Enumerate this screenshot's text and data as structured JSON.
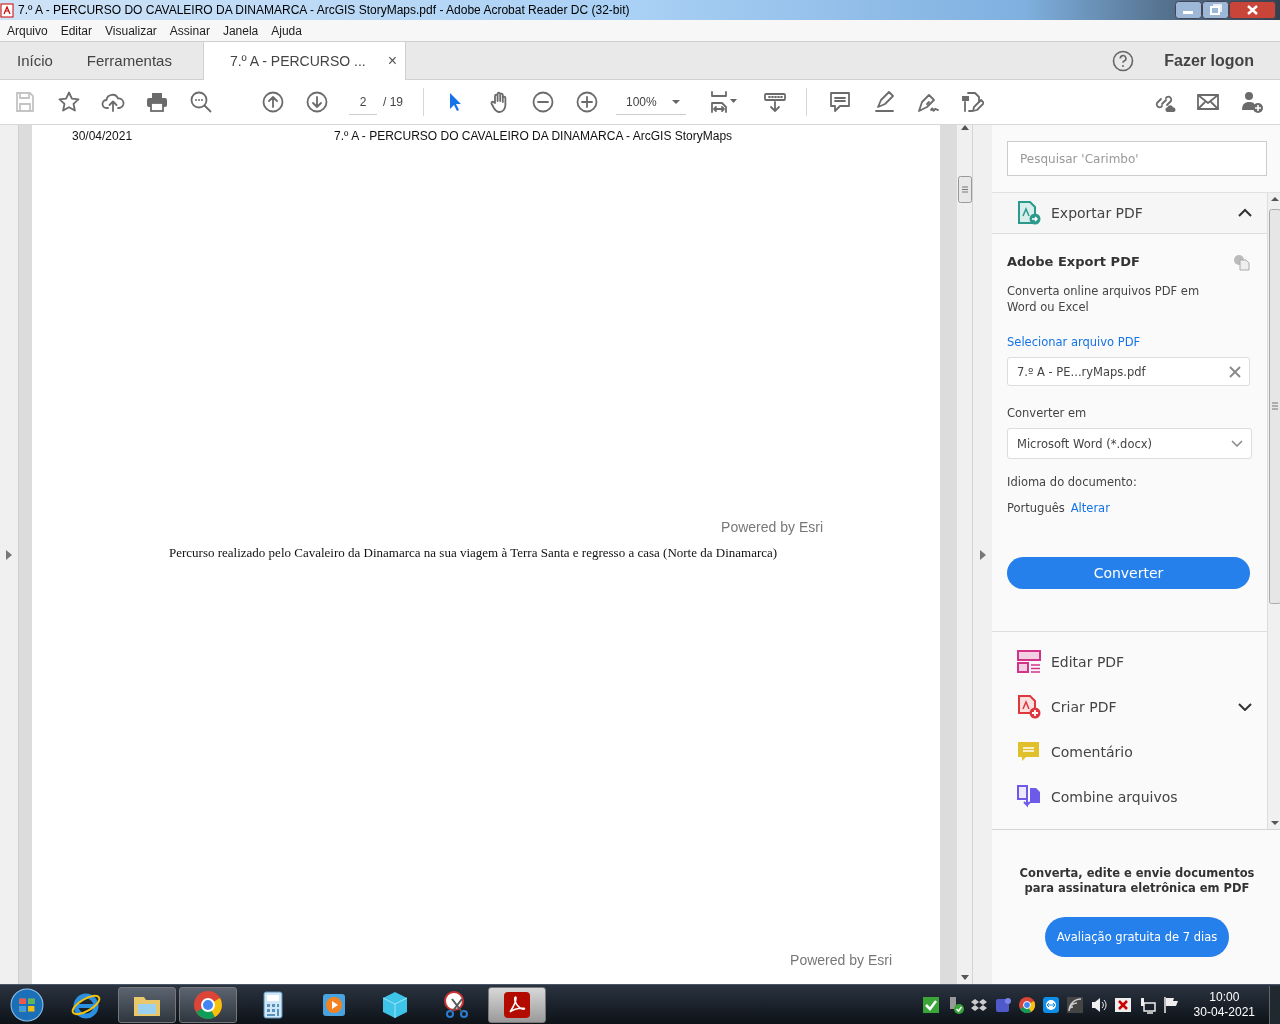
{
  "window": {
    "title": "7.º A - PERCURSO DO CAVALEIRO DA DINAMARCA - ArcGIS StoryMaps.pdf - Adobe Acrobat Reader DC (32-bit)"
  },
  "menu": [
    "Arquivo",
    "Editar",
    "Visualizar",
    "Assinar",
    "Janela",
    "Ajuda"
  ],
  "tabs": [
    {
      "label": "Início",
      "selected": false
    },
    {
      "label": "Ferramentas",
      "selected": false
    },
    {
      "label": "7.º A - PERCURSO ...",
      "selected": true,
      "close": "×"
    }
  ],
  "account": {
    "label": "Fazer logon"
  },
  "toolbar": {
    "save_disabled": true,
    "page": "2",
    "page_total": "/ 19",
    "select_tool_active": true,
    "zoom": "100%"
  },
  "document": {
    "date": "30/04/2021",
    "header_title": "7.º A - PERCURSO DO CAVALEIRO DA DINAMARCA - ArcGIS StoryMaps",
    "credits": [
      "Powered by Esri",
      "Powered by Esri"
    ],
    "caption": "Percurso realizado pelo Cavaleiro da Dinamarca na sua viagem à Terra Santa e regresso a casa (Norte da Dinamarca)"
  },
  "panel": {
    "search": {
      "placeholder": "Pesquisar 'Carimbo'"
    },
    "export": {
      "title": "Exportar PDF",
      "expanded": true,
      "heading": "Adobe Export PDF",
      "description": "Converta online arquivos PDF em Word ou Excel",
      "select_link": "Selecionar arquivo PDF",
      "file": "7.º A - PE...ryMaps.pdf",
      "convert_label": "Converter em",
      "format": "Microsoft Word (*.docx)",
      "language_label": "Idioma do documento:",
      "language": "Português",
      "change_link": "Alterar",
      "button": "Converter"
    },
    "tools": [
      {
        "kind": "edit",
        "label": "Editar PDF",
        "has_menu": false
      },
      {
        "kind": "create",
        "label": "Criar PDF",
        "has_menu": true
      },
      {
        "kind": "comment",
        "label": "Comentário",
        "has_menu": false
      },
      {
        "kind": "combine",
        "label": "Combine arquivos",
        "has_menu": false
      }
    ],
    "promo": {
      "text": "Converta, edite e envie documentos para assinatura eletrônica em PDF",
      "button": "Avaliação gratuita de 7 dias"
    }
  },
  "taskbar": {
    "time": "10:00",
    "date": "30-04-2021"
  }
}
